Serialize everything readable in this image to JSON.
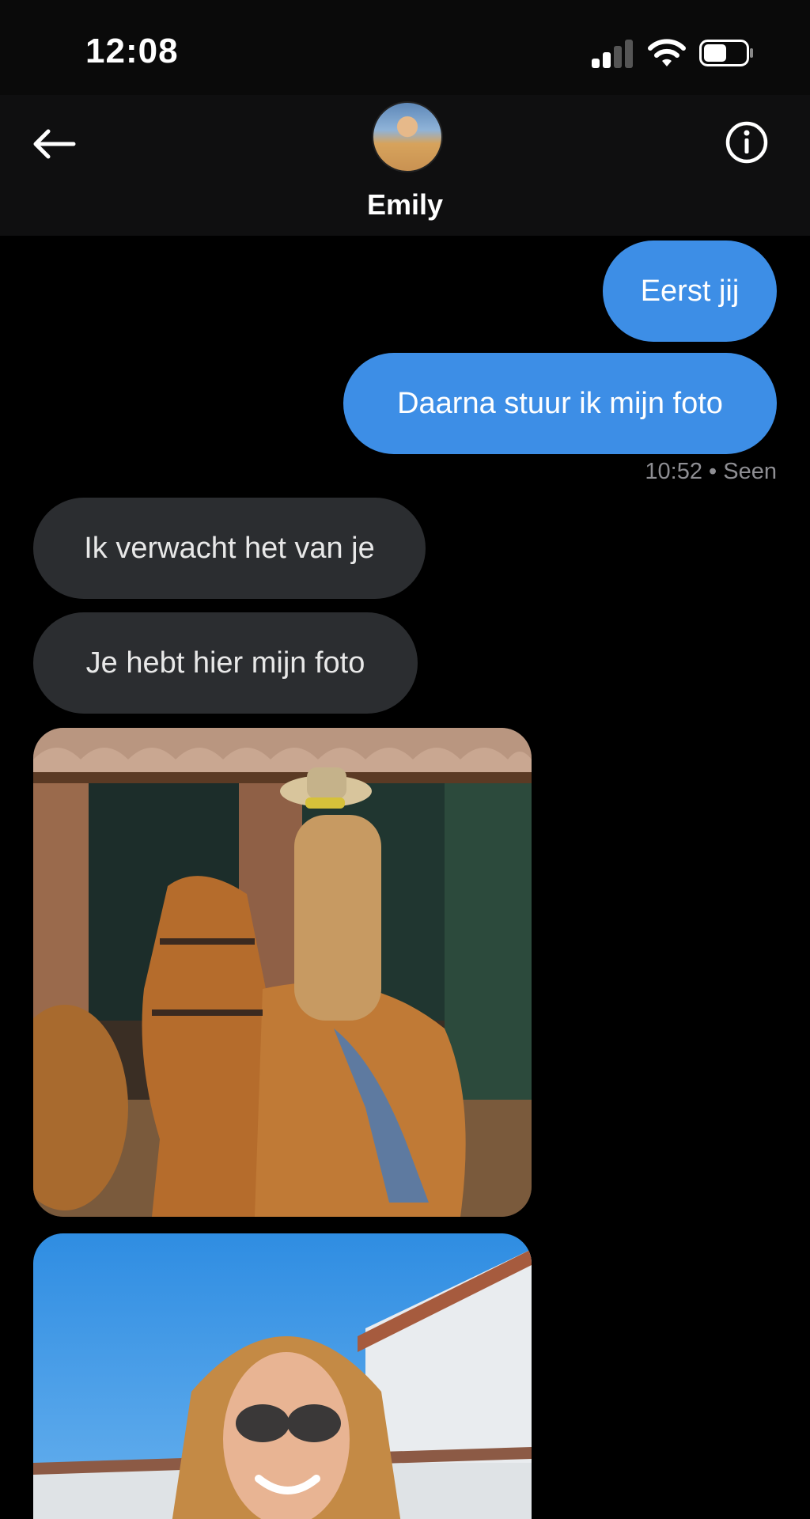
{
  "status_bar": {
    "time": "12:08",
    "battery_level": 0.5
  },
  "header": {
    "contact_name": "Emily",
    "back_icon": "arrow-left-icon",
    "info_icon": "info-circle-icon"
  },
  "messages": [
    {
      "direction": "outgoing",
      "text": "Eerst jij"
    },
    {
      "direction": "outgoing",
      "text": "Daarna stuur ik mijn foto"
    },
    {
      "direction": "incoming",
      "text": "Ik verwacht het van je"
    },
    {
      "direction": "incoming",
      "text": "Je hebt hier mijn foto"
    }
  ],
  "seen_status": "10:52 • Seen",
  "photos": [
    {
      "description": "woman-on-horse-photo"
    },
    {
      "description": "woman-portrait-photo"
    }
  ],
  "colors": {
    "outgoing_bubble": "#3d8ee6",
    "incoming_bubble": "#2b2d30",
    "background": "#000000"
  }
}
